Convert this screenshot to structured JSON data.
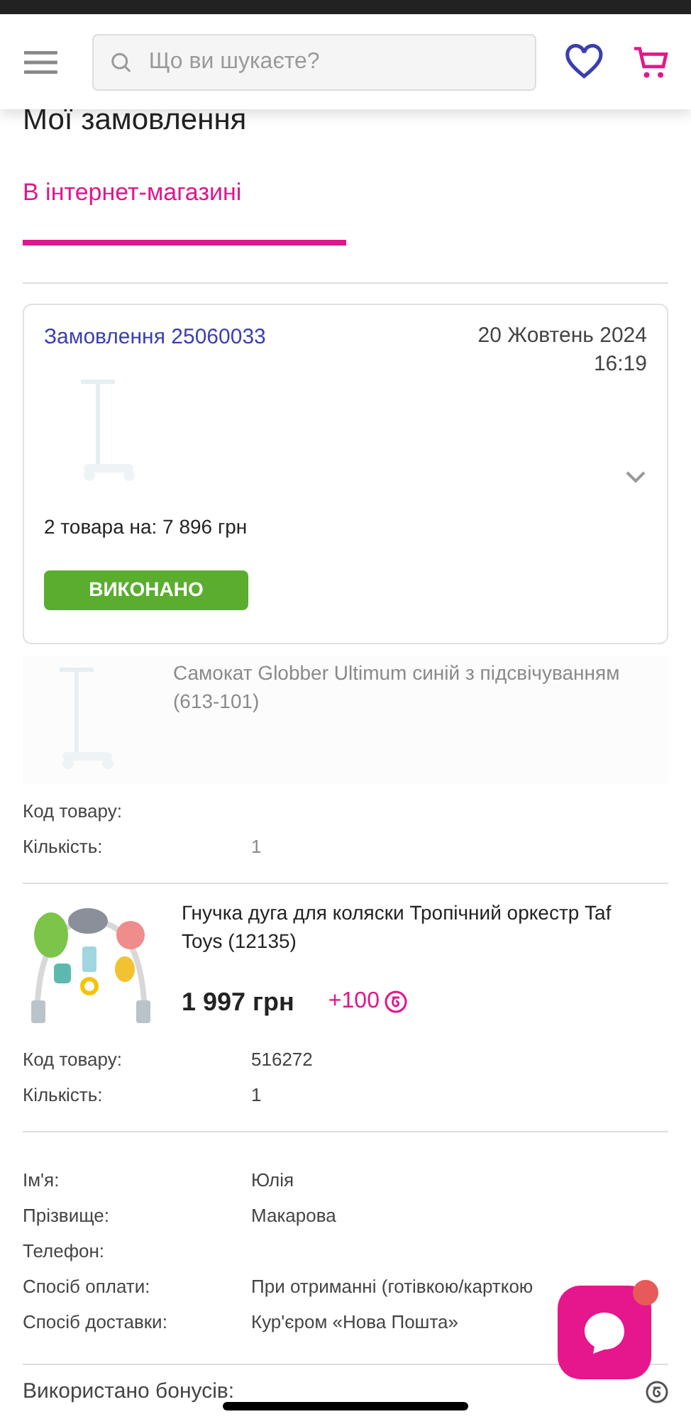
{
  "header": {
    "search": {
      "placeholder": "Що ви шукаєте?"
    }
  },
  "page_title": "Мої замовлення",
  "tabs": [
    {
      "label": "В інтернет-магазині",
      "selected": true
    }
  ],
  "order": {
    "number": "Замовлення 25060033",
    "date": "20 Жовтень 2024",
    "time": "16:19",
    "expanded": false,
    "summary": "2 товара на: 7 896 грн",
    "status": "ВИКОНАНО"
  },
  "items": [
    {
      "name": "Самокат Globber Ultimum синій з підсвічуванням (613-101)",
      "faded": true,
      "details": [
        {
          "label": "Код товару:"
        },
        {
          "label": "Кількість:",
          "value": "1"
        }
      ]
    },
    {
      "name": "Гнучка дуга для коляски Тропічний оркестр Taf Toys (12135)",
      "faded": false,
      "price": "1 997 грн",
      "bonus": "+100",
      "details": [
        {
          "label": "Код товару:",
          "value": "516272"
        },
        {
          "label": "Кількість:",
          "value": "1"
        }
      ]
    }
  ],
  "customer": [
    {
      "label": "Ім'я:",
      "value": "Юлія"
    },
    {
      "label": "Прізвище:",
      "value": "Макарова"
    },
    {
      "label": "Телефон:"
    },
    {
      "label": "Спосіб оплати:",
      "value": "При отриманні (готівкою/карткою"
    },
    {
      "label": "Спосіб доставки:",
      "value": "Кур'єром «Нова Пошта»"
    }
  ],
  "bonus_row": {
    "label": "Використано бонусів:"
  },
  "chat": {
    "unread": true
  }
}
